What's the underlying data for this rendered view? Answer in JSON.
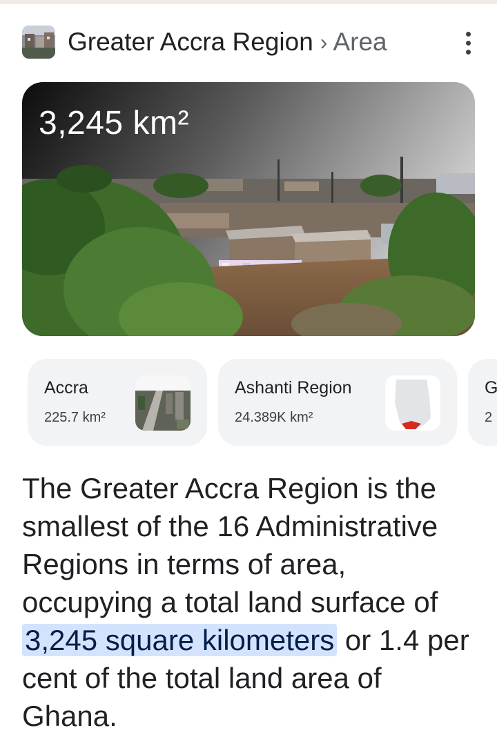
{
  "header": {
    "title": "Greater Accra Region",
    "separator": "›",
    "subtitle": "Area",
    "thumbnail_icon": "city-photo"
  },
  "hero": {
    "value": "3,245 km²",
    "image": "accra-neighborhood-photo"
  },
  "cards": [
    {
      "title": "Accra",
      "value": "225.7 km²",
      "image": "accra-aerial-photo"
    },
    {
      "title": "Ashanti Region",
      "value": "24.389K km²",
      "image": "ghana-map-thumbnail"
    },
    {
      "title": "G",
      "value": "2"
    }
  ],
  "description": {
    "before": "The Greater Accra Region is the smallest of the 16 Administrative Regions in terms of area, occupying a total land surface of ",
    "highlight": "3,245 square kilometers",
    "after": " or 1.4 per cent of the total land area of Ghana."
  },
  "colors": {
    "highlight_bg": "#d3e3fd",
    "card_bg": "#f1f3f4",
    "text": "#202124"
  }
}
